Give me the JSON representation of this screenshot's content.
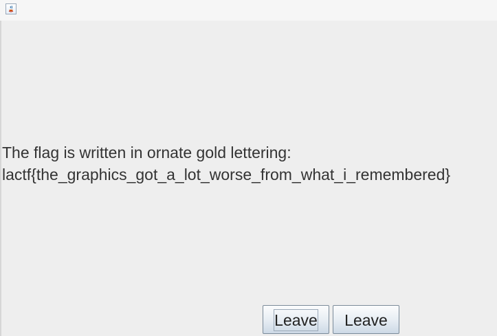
{
  "window": {
    "icon": "java-coffee-icon"
  },
  "message": {
    "line1": "The flag is written in ornate gold lettering:",
    "line2": "lactf{the_graphics_got_a_lot_worse_from_what_i_remembered}"
  },
  "buttons": [
    {
      "label": "Leave",
      "focused": true
    },
    {
      "label": "Leave",
      "focused": false
    }
  ],
  "colors": {
    "background": "#eeeeee",
    "button_border": "#7a8a99",
    "text": "#333333"
  }
}
